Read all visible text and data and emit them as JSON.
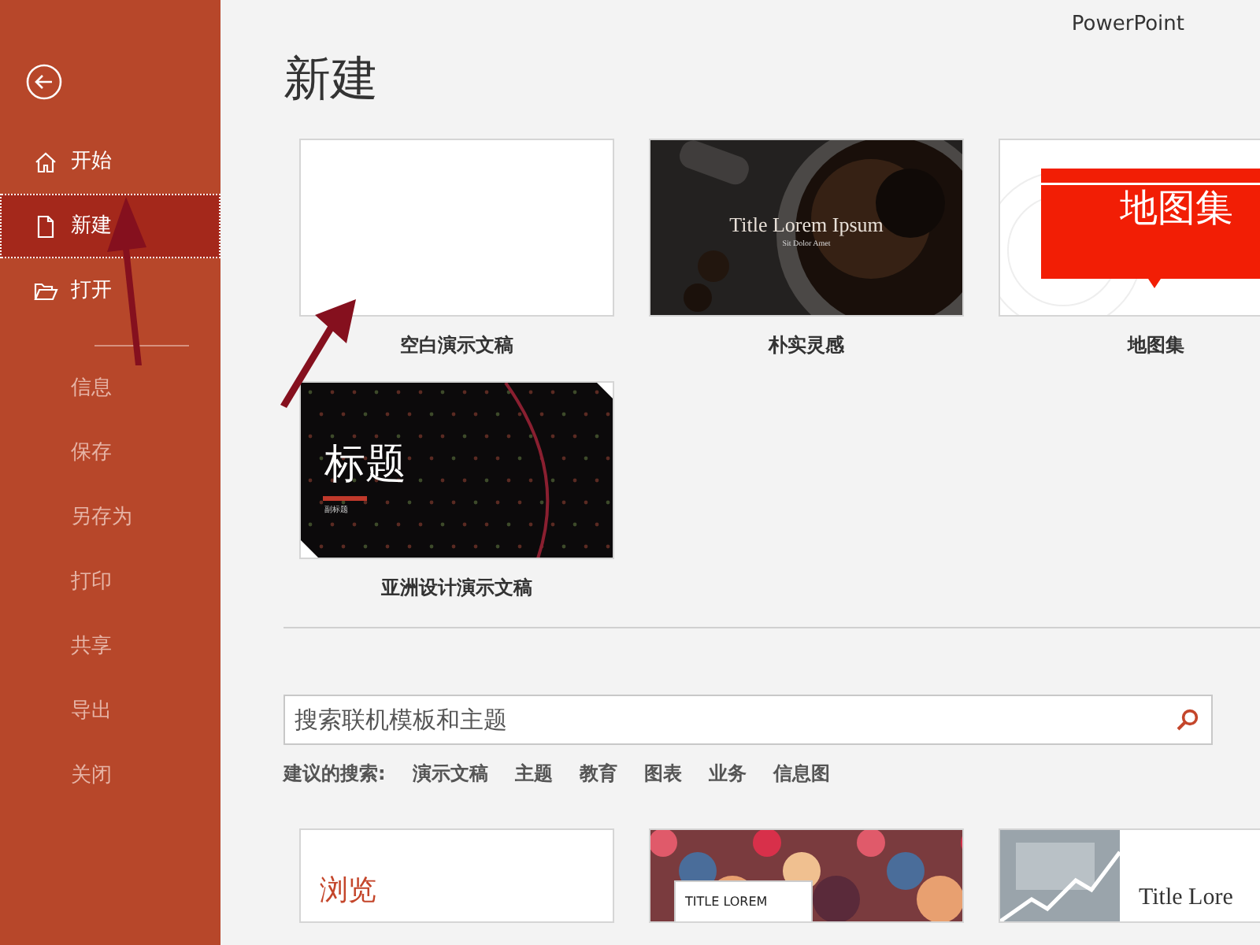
{
  "app_name": "PowerPoint",
  "sidebar": {
    "items": [
      {
        "label": "开始",
        "kind": "home",
        "selected": false
      },
      {
        "label": "新建",
        "kind": "new",
        "selected": true
      },
      {
        "label": "打开",
        "kind": "open",
        "selected": false
      },
      {
        "kind": "divider"
      },
      {
        "label": "信息",
        "kind": "text",
        "selected": false
      },
      {
        "label": "保存",
        "kind": "text",
        "selected": false
      },
      {
        "label": "另存为",
        "kind": "text",
        "selected": false
      },
      {
        "label": "打印",
        "kind": "text",
        "selected": false
      },
      {
        "label": "共享",
        "kind": "text",
        "selected": false
      },
      {
        "label": "导出",
        "kind": "text",
        "selected": false
      },
      {
        "label": "关闭",
        "kind": "text",
        "selected": false
      }
    ]
  },
  "page_title": "新建",
  "templates": [
    {
      "name": "空白演示文稿",
      "kind": "blank"
    },
    {
      "name": "朴实灵感",
      "kind": "coffee",
      "title": "Title Lorem Ipsum",
      "subtitle": "Sit Dolor Amet"
    },
    {
      "name": "地图集",
      "kind": "atlas",
      "title": "地图集"
    },
    {
      "name": "亚洲设计演示文稿",
      "kind": "asia",
      "title": "标题",
      "subtitle": "副标题"
    }
  ],
  "search": {
    "placeholder": "搜索联机模板和主题"
  },
  "suggested": {
    "label": "建议的搜索:",
    "items": [
      "演示文稿",
      "主题",
      "教育",
      "图表",
      "业务",
      "信息图"
    ]
  },
  "featured": [
    {
      "kind": "browse",
      "title": "浏览"
    },
    {
      "kind": "pattern",
      "title": "TITLE LOREM"
    },
    {
      "kind": "chart",
      "title": "Title Lore"
    }
  ],
  "annotations": [
    {
      "kind": "arrow"
    },
    {
      "kind": "arrow"
    }
  ]
}
